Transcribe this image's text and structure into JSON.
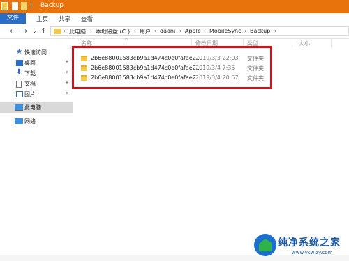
{
  "window": {
    "title": "Backup"
  },
  "ribbon": {
    "tabs": [
      "文件",
      "主页",
      "共享",
      "查看"
    ]
  },
  "nav": {
    "back": "←",
    "forward": "→",
    "recent": "⌄",
    "up": "↑"
  },
  "breadcrumb": [
    "此电脑",
    "本地磁盘 (C:)",
    "用户",
    "daoni",
    "Apple",
    "MobileSync",
    "Backup"
  ],
  "breadcrumb_sep": "›",
  "list_header": {
    "name": "名称",
    "date": "修改日期",
    "type": "类型",
    "size": "大小"
  },
  "sidebar": {
    "quick_access": "快速访问",
    "items": [
      "桌面",
      "下载",
      "文档",
      "图片"
    ],
    "this_pc": "此电脑",
    "network": "网络"
  },
  "files": [
    {
      "name": "2b6e88001583cb9a1d474c0e0fafae2...",
      "date": "2019/3/3 22:03",
      "type": "文件夹"
    },
    {
      "name": "2b6e88001583cb9a1d474c0e0fafae2...",
      "date": "2019/3/4 7:35",
      "type": "文件夹"
    },
    {
      "name": "2b6e88001583cb9a1d474c0e0fafae2...",
      "date": "2019/3/4 20:57",
      "type": "文件夹"
    }
  ],
  "watermark": {
    "title": "纯净系统之家",
    "url": "www.ycwjzy.com"
  },
  "colors": {
    "titlebar": "#e8720c",
    "file_tab": "#2b6cc4",
    "highlight": "#d0111a",
    "folder": "#f2c94c"
  }
}
